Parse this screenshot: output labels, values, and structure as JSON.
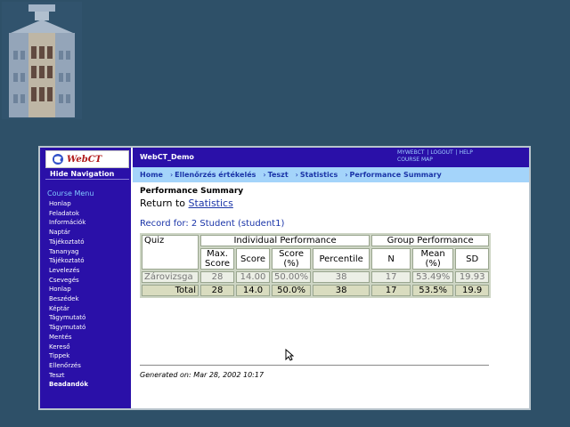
{
  "sidebar": {
    "logo_text": "WebCT",
    "hide_nav": "Hide Navigation",
    "menu_heading": "Course Menu",
    "items": [
      "Honlap",
      "Feladatok",
      "Információk",
      "Naptár",
      "Tájékoztató",
      "Tananyag",
      "Tájékoztató",
      "Levelezés",
      "Csevegés",
      "Honlap",
      "Beszédek",
      "Képtár",
      "Tágymutató",
      "Tágymutató",
      "Mentés",
      "Kereső",
      "Tippek",
      "Ellenőrzés",
      "Teszt",
      "Beadandók"
    ]
  },
  "topbar": {
    "course": "WebCT_Demo",
    "links": [
      "MYWEBCT",
      "LOGOUT",
      "HELP",
      "COURSE MAP"
    ]
  },
  "breadcrumb": [
    "Home",
    "Ellenőrzés értékelés",
    "Teszt",
    "Statistics",
    "Performance Summary"
  ],
  "content": {
    "title": "Performance Summary",
    "return_prefix": "Return to",
    "return_link": "Statistics",
    "record_label": "Record for",
    "record_value": "2 Student (student1)",
    "table": {
      "h_quiz": "Quiz",
      "h_individual": "Individual Performance",
      "h_group": "Group Performance",
      "h_max": "Max. Score",
      "h_score": "Score",
      "h_score_pct": "Score (%)",
      "h_percentile": "Percentile",
      "h_n": "N",
      "h_mean": "Mean (%)",
      "h_sd": "SD",
      "row1": [
        "Zárovizsga",
        "28",
        "14.00",
        "50.00%",
        "38",
        "17",
        "53.49%",
        "19.93"
      ],
      "total": [
        "Total",
        "28",
        "14.0",
        "50.0%",
        "38",
        "17",
        "53.5%",
        "19.9"
      ]
    },
    "generated": "Generated on: Mar 28, 2002 10:17"
  }
}
